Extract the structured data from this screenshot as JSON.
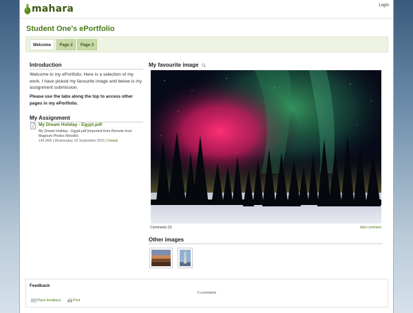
{
  "header": {
    "logo_text": "mahara",
    "login_label": "Login"
  },
  "page": {
    "title": "Student One's ePortfolio"
  },
  "tabs": [
    {
      "label": "Welcome",
      "active": true
    },
    {
      "label": "Page 2",
      "active": false
    },
    {
      "label": "Page 3",
      "active": false
    }
  ],
  "introduction": {
    "title": "Introduction",
    "text": "Welcome to my ePortfolio. Here is a selection of my work. I have picked my favourite image and below is my assignment submission.",
    "bold_text": "Please use the tabs along the top to access other pages in my ePortfolio."
  },
  "assignment": {
    "title": "My Assignment",
    "file_name": "My Dream Holiday - Egypt.pdf",
    "description": "My Dream Holiday - Egypt.pdf (imported from Remote host Magnum Photos Moodle)",
    "meta": "145.0KB | Wednesday, 02 September 2015 |",
    "details_label": "Details"
  },
  "favourite_image": {
    "title": "My favourite image",
    "comments_label": "Comments (2)",
    "add_comment_label": "Add comment"
  },
  "other_images": {
    "title": "Other images"
  },
  "feedback": {
    "title": "Feedback",
    "count": "0 comments",
    "place_feedback": "Place feedback",
    "print": "Print"
  },
  "colors": {
    "brand_green": "#4a7a16",
    "tab_bg": "#c9d9a8",
    "tabbar_bg": "#eef3e4"
  },
  "icons": [
    "mahara-logo-icon",
    "zoom-icon",
    "pdf-file-icon",
    "feedback-icon",
    "print-icon"
  ]
}
